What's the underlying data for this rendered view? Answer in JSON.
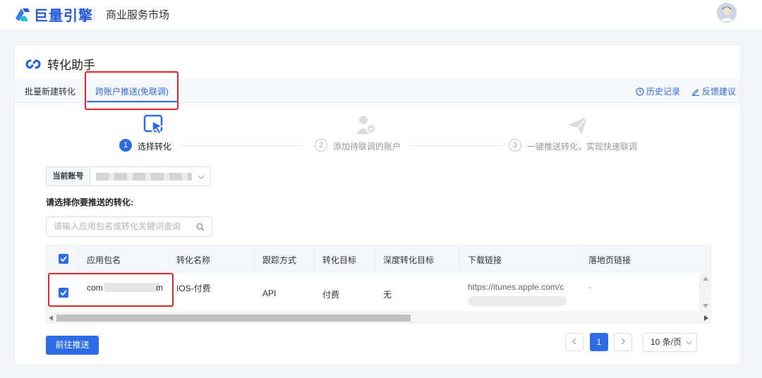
{
  "header": {
    "brand": "巨量引擎",
    "market": "商业服务市场"
  },
  "card": {
    "title": "转化助手"
  },
  "tabs": [
    {
      "label": "批量新建转化",
      "active": false
    },
    {
      "label": "跨账户推送(免联调)",
      "active": true
    }
  ],
  "links": {
    "history": "历史记录",
    "feedback": "反馈建议"
  },
  "steps": [
    {
      "num": "1",
      "label": "选择转化",
      "active": true
    },
    {
      "num": "2",
      "label": "添加待联调的账户",
      "active": false
    },
    {
      "num": "3",
      "label": "一键推送转化，实现快速联调",
      "active": false
    }
  ],
  "account": {
    "label": "当前账号"
  },
  "select_prompt": "请选择你要推送的转化:",
  "search": {
    "placeholder": "请输入应用包名或转化关键词查询"
  },
  "table": {
    "columns": [
      "应用包名",
      "转化名称",
      "跟踪方式",
      "转化目标",
      "深度转化目标",
      "下载链接",
      "落地页链接"
    ],
    "rows": [
      {
        "package_prefix": "com",
        "package_suffix": "m",
        "conversion_name": "IOS-付费",
        "tracking": "API",
        "target": "付费",
        "deep_target": "无",
        "download_link": "https://itunes.apple.com/c",
        "landing_link": "-"
      }
    ]
  },
  "actions": {
    "push": "前往推送"
  },
  "pagination": {
    "current": "1",
    "page_size": "10 条/页"
  },
  "colors": {
    "accent": "#2e6be6",
    "highlight": "#e5262b"
  }
}
